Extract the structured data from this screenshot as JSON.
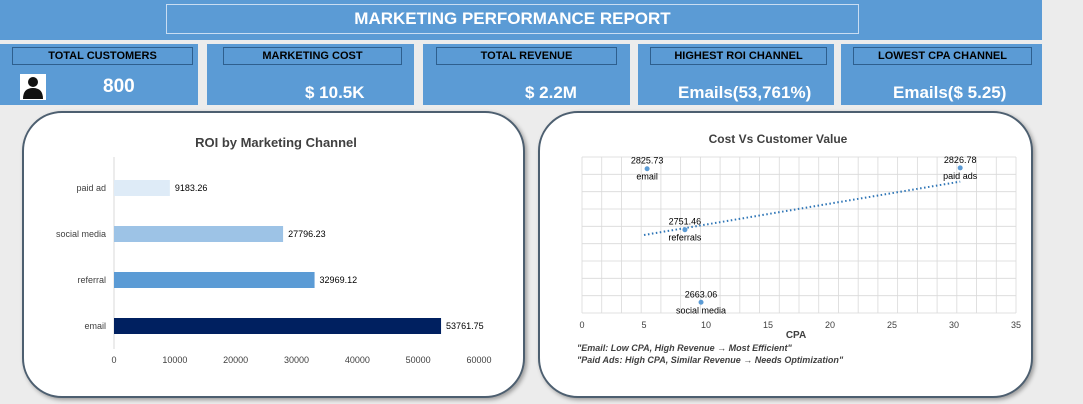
{
  "report_title": "MARKETING PERFORMANCE REPORT",
  "kpis": [
    {
      "title": "TOTAL CUSTOMERS",
      "value": "800",
      "icon": "person-icon"
    },
    {
      "title": "MARKETING COST",
      "value": "$ 10.5K"
    },
    {
      "title": "TOTAL REVENUE",
      "value": "$ 2.2M"
    },
    {
      "title": "HIGHEST ROI CHANNEL",
      "value": "Emails(53,761%)"
    },
    {
      "title": "LOWEST CPA CHANNEL",
      "value": "Emails($ 5.25)"
    }
  ],
  "colors": {
    "header": "#5b9bd5",
    "accent_dark": "#002060"
  },
  "chart_data": [
    {
      "type": "bar",
      "orientation": "horizontal",
      "title": "ROI  by Marketing Channel",
      "categories": [
        "paid ad",
        "social media",
        "referral",
        "email"
      ],
      "values": [
        9183.26,
        27796.23,
        32969.12,
        53761.75
      ],
      "value_labels": [
        "9183.26",
        "27796.23",
        "32969.12",
        "53761.75"
      ],
      "bar_colors": [
        "#deebf7",
        "#9dc3e6",
        "#5b9bd5",
        "#002060"
      ],
      "xlim": [
        0,
        60000
      ],
      "xticks": [
        0,
        10000,
        20000,
        30000,
        40000,
        50000,
        60000
      ],
      "xlabel": "",
      "ylabel": ""
    },
    {
      "type": "scatter",
      "title": "Cost Vs Customer Value",
      "xlabel": "CPA",
      "ylabel": "",
      "xlim": [
        0,
        35
      ],
      "xticks": [
        0,
        5,
        10,
        15,
        20,
        25,
        30,
        35
      ],
      "points": [
        {
          "label": "email",
          "x": 5.25,
          "y": 2825.73,
          "value_label": "2825.73"
        },
        {
          "label": "paid ads",
          "x": 30.5,
          "y": 2826.78,
          "value_label": "2826.78"
        },
        {
          "label": "referrals",
          "x": 8.3,
          "y": 2751.46,
          "value_label": "2751.46"
        },
        {
          "label": "social media",
          "x": 9.6,
          "y": 2663.06,
          "value_label": "2663.06"
        }
      ],
      "trendline": {
        "style": "dotted",
        "from": [
          5,
          2745
        ],
        "to": [
          30.5,
          2810
        ]
      },
      "grid": true,
      "annotations": [
        "\"Email: Low CPA, High Revenue → Most Efficient\"",
        "\"Paid Ads: High CPA, Similar Revenue → Needs Optimization\""
      ]
    }
  ]
}
